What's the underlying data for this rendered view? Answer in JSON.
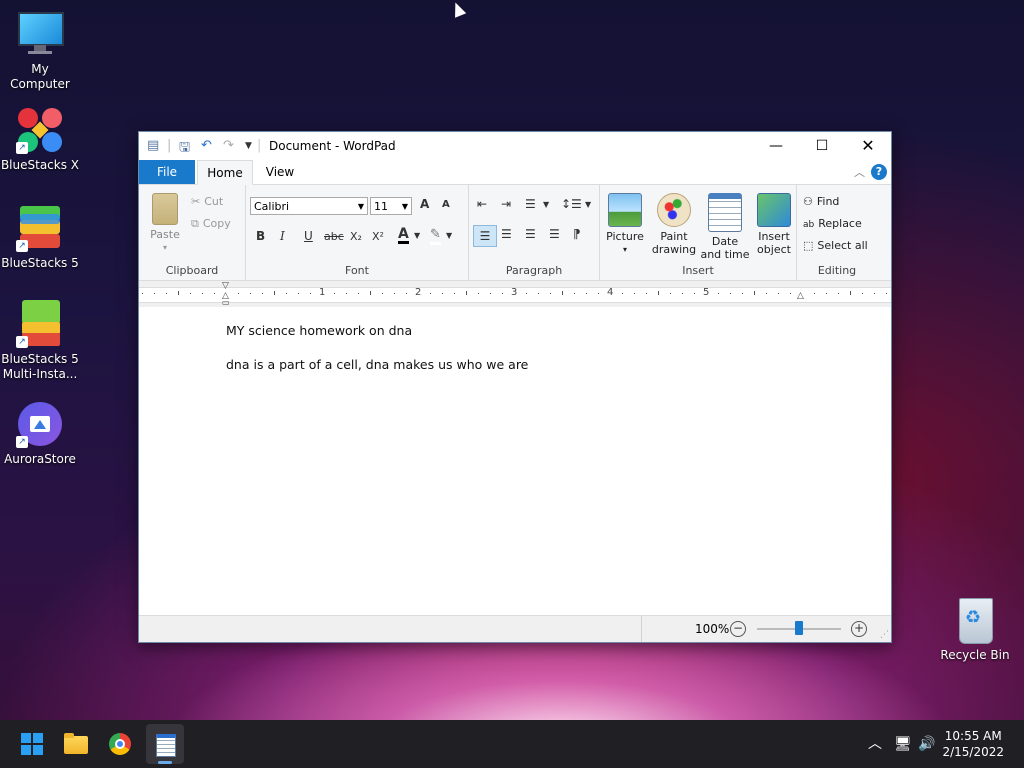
{
  "desktop": {
    "icons": [
      {
        "label": "My Computer"
      },
      {
        "label": "BlueStacks X"
      },
      {
        "label": "BlueStacks 5"
      },
      {
        "label": "BlueStacks 5 Multi-Insta..."
      },
      {
        "label": "AuroraStore"
      },
      {
        "label": "Recycle Bin"
      }
    ]
  },
  "window": {
    "title": "Document - WordPad",
    "tabs": {
      "file": "File",
      "home": "Home",
      "view": "View"
    },
    "clipboard": {
      "paste": "Paste",
      "cut": "Cut",
      "copy": "Copy",
      "label": "Clipboard"
    },
    "font": {
      "family": "Calibri",
      "size": "11",
      "label": "Font",
      "grow": "A",
      "shrink": "A",
      "bold": "B",
      "italic": "I",
      "underline": "U",
      "strike": "abc",
      "sub": "X₂",
      "sup": "X²",
      "color": "A"
    },
    "paragraph": {
      "label": "Paragraph"
    },
    "insert": {
      "picture": "Picture",
      "paint": "Paint drawing",
      "datetime": "Date and time",
      "object": "Insert object",
      "label": "Insert"
    },
    "editing": {
      "find": "Find",
      "replace": "Replace",
      "select_all": "Select all",
      "label": "Editing"
    },
    "ruler": {
      "numbers": [
        "1",
        "2",
        "3",
        "4",
        "5"
      ]
    },
    "document": {
      "lines": [
        "MY science homework on dna",
        "dna is a part of a cell, dna makes us who we are"
      ]
    },
    "status": {
      "zoom": "100%",
      "zoom_level_percent": 100
    }
  },
  "taskbar": {
    "time": "10:55 AM",
    "date": "2/15/2022"
  },
  "colors": {
    "accent": "#1979ca",
    "taskbar": "#1f1f24"
  }
}
